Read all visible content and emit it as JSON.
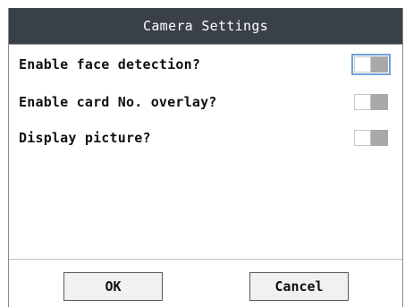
{
  "dialog": {
    "title": "Camera Settings"
  },
  "settings": [
    {
      "label": "Enable face detection?",
      "enabled": false,
      "focused": true
    },
    {
      "label": "Enable card No. overlay?",
      "enabled": false,
      "focused": false
    },
    {
      "label": "Display picture?",
      "enabled": false,
      "focused": false
    }
  ],
  "buttons": {
    "ok_label": "OK",
    "cancel_label": "Cancel"
  },
  "colors": {
    "title_bar": "#3a4049",
    "toggle_track": "#a9a9a9",
    "focus_outline": "#6fa2d9"
  }
}
